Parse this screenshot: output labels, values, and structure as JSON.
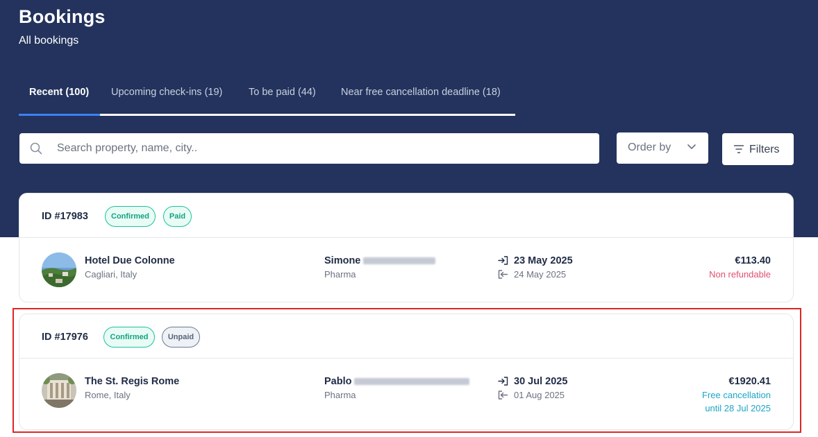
{
  "header": {
    "title": "Bookings",
    "subtitle": "All bookings"
  },
  "tabs": [
    {
      "label": "Recent (100)",
      "active": true
    },
    {
      "label": "Upcoming check-ins (19)",
      "active": false
    },
    {
      "label": "To be paid (44)",
      "active": false
    },
    {
      "label": "Near free cancellation deadline (18)",
      "active": false
    }
  ],
  "search": {
    "placeholder": "Search property, name, city.."
  },
  "order_by": {
    "label": "Order by"
  },
  "filters": {
    "label": "Filters"
  },
  "bookings": [
    {
      "id": "ID #17983",
      "badges": [
        "Confirmed",
        "Paid"
      ],
      "property": "Hotel Due Colonne",
      "location": "Cagliari, Italy",
      "guest_first": "Simone",
      "company": "Pharma",
      "check_in": "23 May 2025",
      "check_out": "24 May 2025",
      "price": "€113.40",
      "cancellation_line1": "Non refundable",
      "cancellation_line2": ""
    },
    {
      "id": "ID #17976",
      "badges": [
        "Confirmed",
        "Unpaid"
      ],
      "property": "The St. Regis Rome",
      "location": "Rome, Italy",
      "guest_first": "Pablo",
      "company": "Pharma",
      "check_in": "30 Jul 2025",
      "check_out": "01 Aug 2025",
      "price": "€1920.41",
      "cancellation_line1": "Free cancellation",
      "cancellation_line2": "until 28 Jul 2025"
    }
  ],
  "colors": {
    "header_bg": "#23335d",
    "active_tab_underline": "#3b82f6",
    "badge_green": "#19c39a",
    "non_refundable": "#e0506f",
    "free_cancellation": "#1aa6c4",
    "highlight_border": "#e02424"
  }
}
